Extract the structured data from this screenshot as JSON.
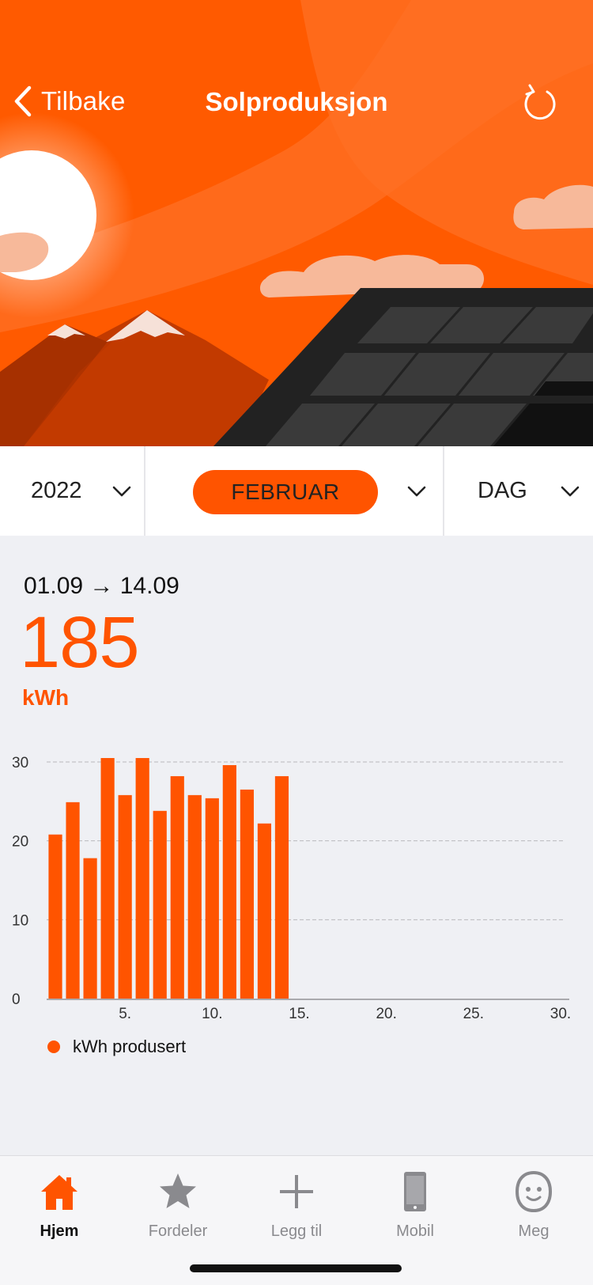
{
  "header": {
    "back_label": "Tilbake",
    "title": "Solproduksjon",
    "icons": {
      "back": "chevron-left-icon",
      "refresh": "refresh-icon"
    }
  },
  "selectors": {
    "year": "2022",
    "month": "FEBRUAR",
    "period": "DAG"
  },
  "summary": {
    "range": "01.09 → 14.09",
    "value": "185",
    "unit": "kWh"
  },
  "legend": {
    "label": "kWh produsert"
  },
  "colors": {
    "accent": "#ff5400",
    "hero_bg": "#ff5a00"
  },
  "chart_data": {
    "type": "bar",
    "x": [
      1,
      2,
      3,
      4,
      5,
      6,
      7,
      8,
      9,
      10,
      11,
      12,
      13,
      14
    ],
    "values": [
      20.8,
      24.9,
      17.8,
      30.5,
      25.8,
      30.5,
      23.8,
      28.2,
      25.8,
      25.4,
      29.6,
      26.5,
      22.2,
      28.2
    ],
    "xlim": [
      0.5,
      30.5
    ],
    "ylim": [
      0,
      30
    ],
    "x_ticks": [
      "5.",
      "10.",
      "15.",
      "20.",
      "25.",
      "30."
    ],
    "y_ticks": [
      "0",
      "10",
      "20",
      "30"
    ],
    "grid": true,
    "legend": "bottom-left"
  },
  "tabs": [
    {
      "label": "Hjem",
      "icon": "home-icon",
      "active": true
    },
    {
      "label": "Fordeler",
      "icon": "star-icon",
      "active": false
    },
    {
      "label": "Legg til",
      "icon": "plus-icon",
      "active": false
    },
    {
      "label": "Mobil",
      "icon": "phone-icon",
      "active": false
    },
    {
      "label": "Meg",
      "icon": "face-icon",
      "active": false
    }
  ]
}
